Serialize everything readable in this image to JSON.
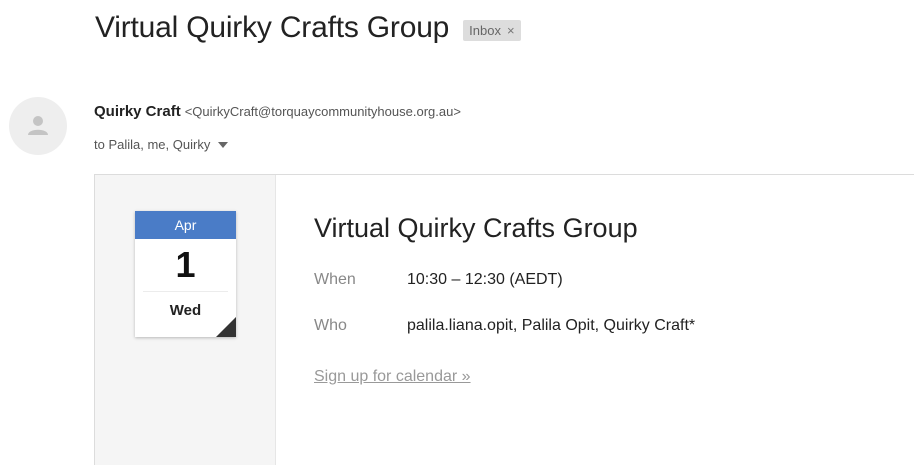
{
  "email": {
    "subject": "Virtual Quirky Crafts Group",
    "label_chip": {
      "text": "Inbox",
      "remove_glyph": "×"
    },
    "sender": {
      "name": "Quirky Craft",
      "email": "<QuirkyCraft@torquaycommunityhouse.org.au>",
      "avatar_icon": "person-icon"
    },
    "recipients": "to Palila, me, Quirky",
    "recipients_caret_icon": "caret-down-icon"
  },
  "invite": {
    "calendar_icon": {
      "month": "Apr",
      "day": "1",
      "weekday": "Wed",
      "month_color": "#4a7cc7"
    },
    "title": "Virtual Quirky Crafts Group",
    "when_label": "When",
    "when_value": "10:30 – 12:30 (AEDT)",
    "who_label": "Who",
    "who_value": "palila.liana.opit, Palila Opit, Quirky Craft*",
    "signup_link": "Sign up for calendar »"
  }
}
